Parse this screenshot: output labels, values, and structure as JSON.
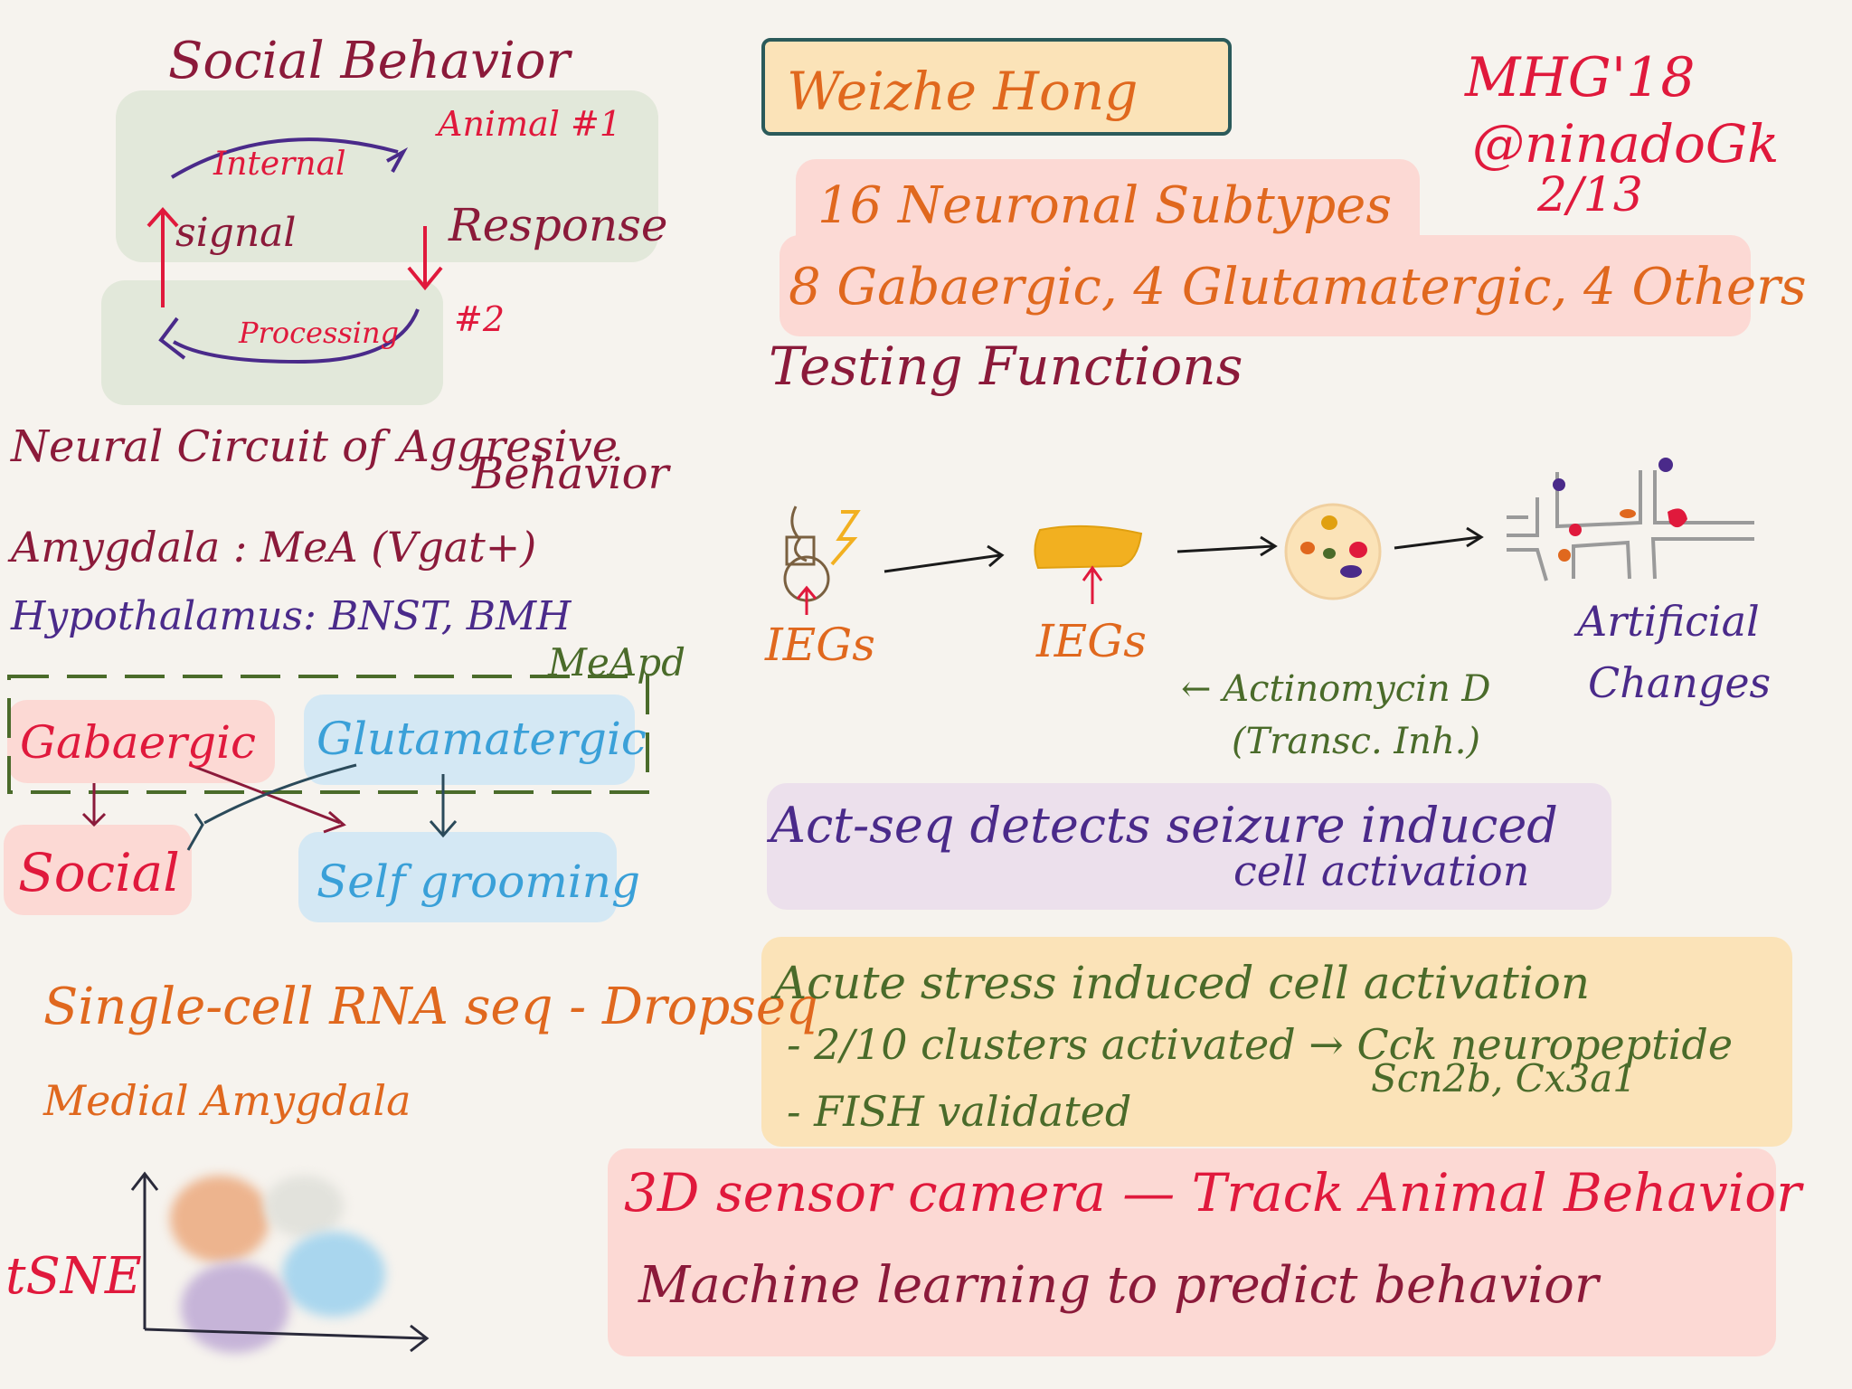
{
  "header": {
    "speaker": "Weizhe Hong",
    "event": "MHG'18",
    "author": "@ninadoGk",
    "date": "2/13"
  },
  "social": {
    "title": "Social Behavior",
    "animal1": "Animal #1",
    "internal": "Internal",
    "signal": "signal",
    "response": "Response",
    "processing": "Processing",
    "animal2": "#2"
  },
  "circuit": {
    "title_line1": "Neural Circuit of Aggresive",
    "title_line2": "Behavior",
    "amygdala": "Amygdala : MeA (Vgat+)",
    "hypothalamus": "Hypothalamus: BNST, BMH",
    "meapd": "MeApd",
    "gabaergic": "Gabaergic",
    "glutamatergic": "Glutamatergic",
    "social": "Social",
    "selfgrooming": "Self grooming"
  },
  "scrna": {
    "line1": "Single-cell RNA seq - Dropseq",
    "line2": "Medial Amygdala",
    "tsne": "tSNE"
  },
  "subtypes": {
    "line1": "16 Neuronal Subtypes",
    "line2": "8 Gabaergic, 4 Glutamatergic, 4 Others",
    "testing": "Testing Functions"
  },
  "pipeline": {
    "ieg1": "IEGs",
    "ieg2": "IEGs",
    "actinomycin": "← Actinomycin D",
    "transc": "(Transc. Inh.)",
    "artificial_line1": "Artificial",
    "artificial_line2": "Changes"
  },
  "actseq": {
    "line1": "Act-seq detects seizure induced",
    "line2": "cell activation"
  },
  "stress": {
    "line1": "Acute stress induced cell activation",
    "line2": "- 2/10 clusters activated → Cck neuropeptide",
    "line3": "Scn2b, Cx3a1",
    "line4": "- FISH validated"
  },
  "camera": {
    "line1": "3D sensor camera — Track Animal Behavior",
    "line2": "Machine learning to predict behavior"
  },
  "colors": {
    "background": "#f6f3ee",
    "crimson": "#8b1a3a",
    "red": "#e0193c",
    "orange": "#e0681e",
    "olive": "#4a6b2a",
    "blue": "#3aa0d8",
    "purple": "#4a2a8a",
    "pink_hl": "#fcd9d4",
    "green_hl": "#e2e8da",
    "blue_hl": "#d4e8f4",
    "lilac_hl": "#ece0ec",
    "yellow_hl": "#fbe3b8"
  }
}
